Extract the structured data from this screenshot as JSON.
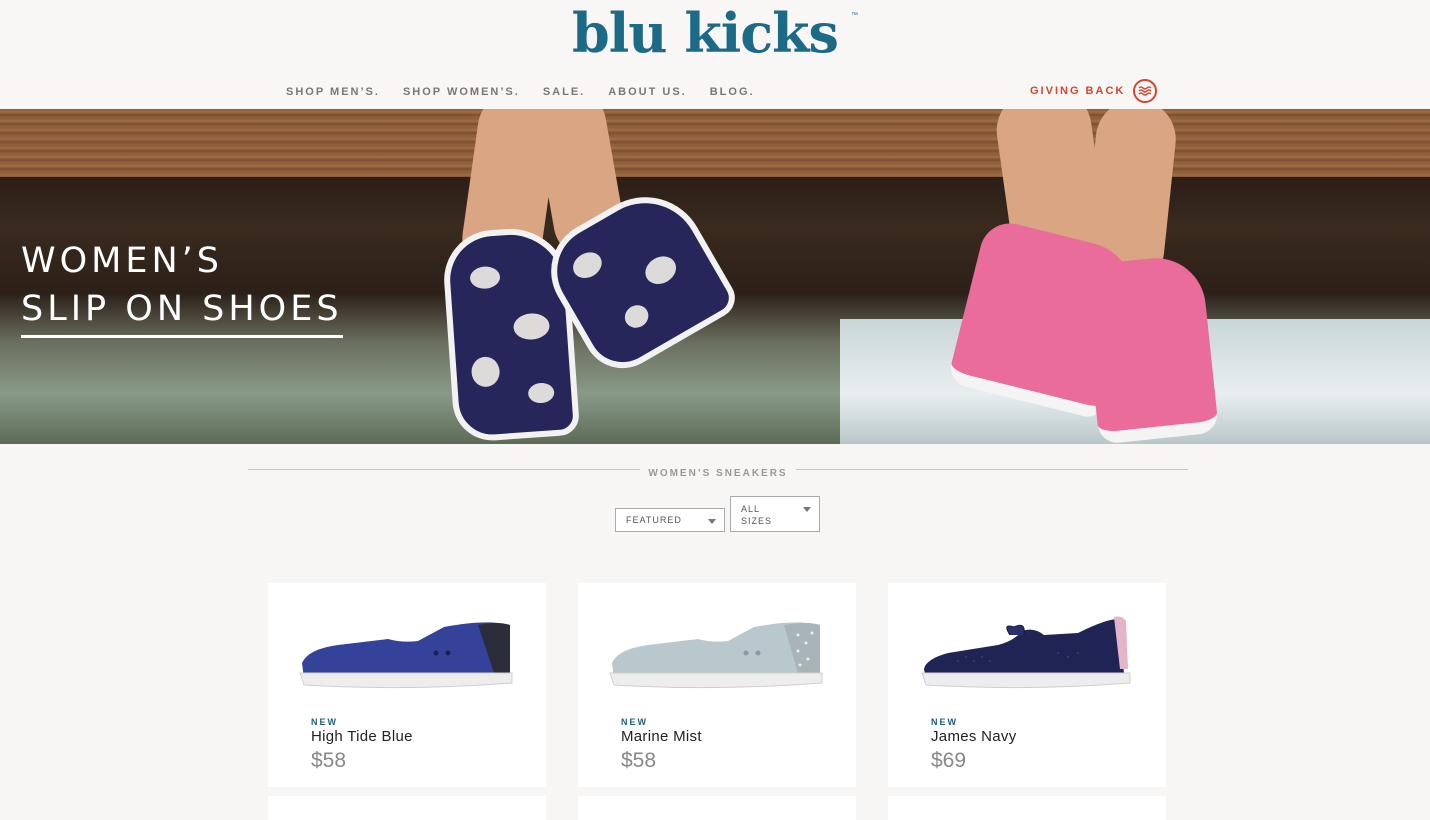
{
  "brand": {
    "logo": "blu kicks",
    "tm": "™"
  },
  "nav": {
    "items": [
      "SHOP MEN’S.",
      "SHOP WOMEN’S.",
      "SALE.",
      "ABOUT US.",
      "BLOG."
    ],
    "giving_back": "GIVING BACK"
  },
  "hero": {
    "line1": "WOMEN’S",
    "line2": "SLIP ON SHOES"
  },
  "section": {
    "title": "WOMEN’S SNEAKERS"
  },
  "filters": {
    "sort": {
      "selected": "FEATURED"
    },
    "size": {
      "selected_line1": "ALL",
      "selected_line2": "SIZES"
    }
  },
  "products": [
    {
      "badge": "NEW",
      "name": "High Tide Blue",
      "price": "$58",
      "shoe_color": "#34429a"
    },
    {
      "badge": "NEW",
      "name": "Marine Mist",
      "price": "$58",
      "shoe_color": "#b9c8cd"
    },
    {
      "badge": "NEW",
      "name": "James Navy",
      "price": "$69",
      "shoe_color": "#1f2455"
    }
  ],
  "colors": {
    "brand": "#1d6a86",
    "accent": "#d8442f"
  }
}
